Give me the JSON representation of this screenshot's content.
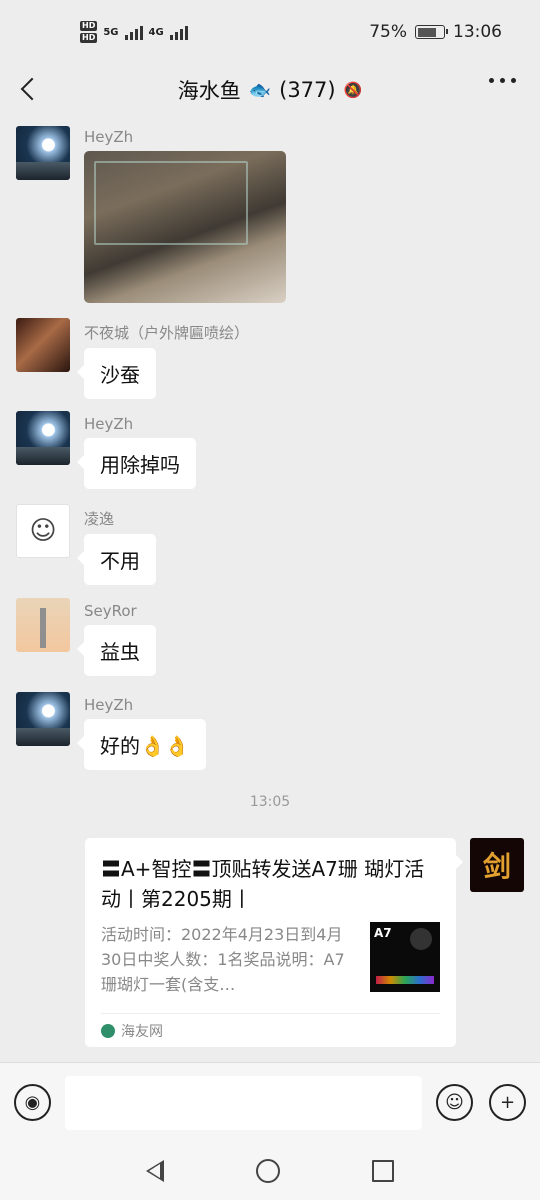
{
  "status_bar": {
    "signal_1": "5G",
    "signal_2": "4G",
    "battery": "75%",
    "battery_level": 0.75,
    "time": "13:06"
  },
  "nav": {
    "title": "海水鱼",
    "fish_icon": "fish-icon",
    "member_count": "(377)",
    "mute_icon": "bell-slash-icon"
  },
  "messages": [
    {
      "sender": "HeyZh",
      "type": "image"
    },
    {
      "sender": "不夜城（户外牌匾喷绘）",
      "text": "沙蚕"
    },
    {
      "sender": "HeyZh",
      "text": "用除掉吗"
    },
    {
      "sender": "凌逸",
      "text": "不用"
    },
    {
      "sender": "SeyRor",
      "text": "益虫"
    },
    {
      "sender": "HeyZh",
      "text": "好的",
      "emoji": "👌👌"
    }
  ],
  "time_divider": "13:05",
  "card": {
    "title": "〓A+智控〓顶贴转发送A7珊 瑚灯活动丨第2205期丨",
    "description": "活动时间：2022年4月23日到4月30日中奖人数：1名奖品说明：A7珊瑚灯一套(含支…",
    "thumb_label": "A7",
    "source": "海友网"
  },
  "input": {
    "voice_icon": "voice-icon",
    "emoji_icon": "smiley-icon",
    "plus_icon": "plus-icon",
    "placeholder": ""
  }
}
